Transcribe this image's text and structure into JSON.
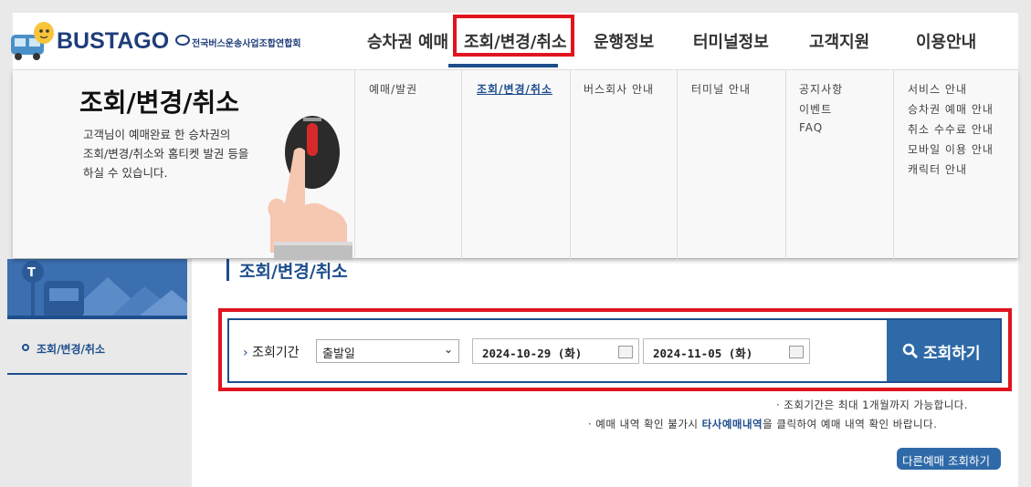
{
  "header": {
    "logo_text": "BUSTAGO",
    "org_name": "전국버스운송사업조합연합회",
    "nav": [
      "승차권 예매",
      "조회/변경/취소",
      "운행정보",
      "터미널정보",
      "고객지원",
      "이용안내"
    ],
    "active_nav": "조회/변경/취소"
  },
  "mega_menu": {
    "title": "조회/변경/취소",
    "description": [
      "고객님이 예매완료 한 승차권의",
      "조회/변경/취소와 홈티켓 발권 등을",
      "하실 수 있습니다."
    ],
    "columns": [
      [
        "예매/발권"
      ],
      [
        "조회/변경/취소"
      ],
      [
        "버스회사 안내"
      ],
      [
        "터미널 안내"
      ],
      [
        "공지사항",
        "이벤트",
        "FAQ"
      ],
      [
        "서비스 안내",
        "승차권 예매 안내",
        "취소 수수료 안내",
        "모바일 이용 안내",
        "캐릭터 안내"
      ]
    ]
  },
  "sidebar": {
    "items": [
      "조회/변경/취소"
    ]
  },
  "main": {
    "heading": "조회/변경/취소",
    "search": {
      "period_label": "조회기간",
      "period_select": "출발일",
      "date_from": "2024-10-29 (화)",
      "date_to": "2024-11-05 (화)",
      "submit_label": "조회하기"
    },
    "notes": {
      "note1": "· 조회기간은 최대 1개월까지 가능합니다.",
      "note2_pre": "· 예매 내역 확인 불가시 ",
      "note2_link": "타사예매내역",
      "note2_post": "을 클릭하여 예매 내역 확인 바랍니다."
    },
    "other_button": "다른예매 조회하기"
  },
  "colors": {
    "brand": "#1e4e8c",
    "button": "#2f6aa8",
    "highlight": "#e0141f"
  }
}
